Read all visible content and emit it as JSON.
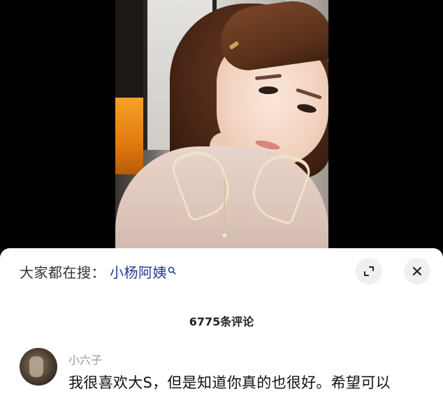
{
  "search": {
    "prefix": "大家都在搜：",
    "term": "小杨阿姨"
  },
  "buttons": {
    "expand_icon": "expand-icon",
    "close_icon": "close-icon"
  },
  "comments": {
    "count_text": "6775条评论",
    "items": [
      {
        "username": "小六子",
        "text": "我很喜欢大S，但是知道你真的也很好。希望可以"
      }
    ]
  },
  "colors": {
    "search_term": "#1f3d8a",
    "sheet_bg": "#ffffff",
    "button_bg": "#f0f0f0"
  }
}
